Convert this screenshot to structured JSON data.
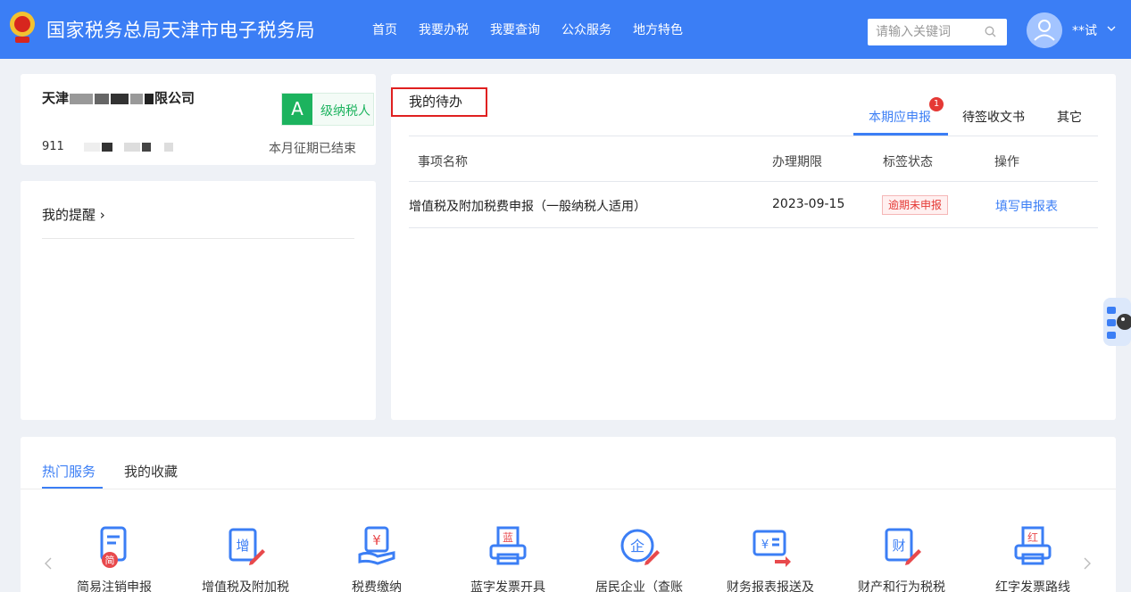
{
  "header": {
    "site_title": "国家税务总局天津市电子税务局",
    "nav": [
      "首页",
      "我要办税",
      "我要查询",
      "公众服务",
      "地方特色"
    ],
    "search_placeholder": "请输入关键词",
    "username": "**试",
    "colors": {
      "header_bg": "#3b7ef5"
    },
    "icons": {
      "emblem": "tax-emblem-icon",
      "search": "search-icon",
      "user": "user-avatar-icon",
      "caret": "chevron-down-icon"
    }
  },
  "company": {
    "name_start": "天津",
    "name_end": "限公司",
    "tax_id_prefix": "911",
    "grade_letter": "A",
    "grade_text": "级纳税人",
    "levy_status": "本月征期已结束"
  },
  "reminders": {
    "title": "我的提醒 ›"
  },
  "todo": {
    "title": "我的待办",
    "tabs": [
      {
        "label": "本期应申报",
        "badge": "1",
        "active": true
      },
      {
        "label": "待签收文书",
        "active": false
      },
      {
        "label": "其它",
        "active": false
      }
    ],
    "columns": [
      "事项名称",
      "办理期限",
      "标签状态",
      "操作"
    ],
    "rows": [
      {
        "name": "增值税及附加税费申报（一般纳税人适用）",
        "deadline": "2023-09-15",
        "status": "逾期未申报",
        "action": "填写申报表"
      }
    ]
  },
  "services": {
    "tabs": [
      {
        "label": "热门服务",
        "active": true
      },
      {
        "label": "我的收藏",
        "active": false
      }
    ],
    "items": [
      {
        "label": "简易注销申报",
        "icon": "document-simple-icon",
        "glyph": "简"
      },
      {
        "label": "增值税及附加税",
        "icon": "vat-edit-icon",
        "glyph": "增"
      },
      {
        "label": "税费缴纳",
        "icon": "tax-payment-icon",
        "glyph": "¥"
      },
      {
        "label": "蓝字发票开具",
        "icon": "blue-invoice-printer-icon",
        "glyph": "蓝"
      },
      {
        "label": "居民企业（查账",
        "icon": "enterprise-edit-icon",
        "glyph": "企"
      },
      {
        "label": "财务报表报送及",
        "icon": "financial-report-send-icon",
        "glyph": "¥"
      },
      {
        "label": "财产和行为税税",
        "icon": "property-tax-edit-icon",
        "glyph": "财"
      },
      {
        "label": "红字发票路线",
        "icon": "red-invoice-printer-icon",
        "glyph": "红"
      }
    ]
  }
}
